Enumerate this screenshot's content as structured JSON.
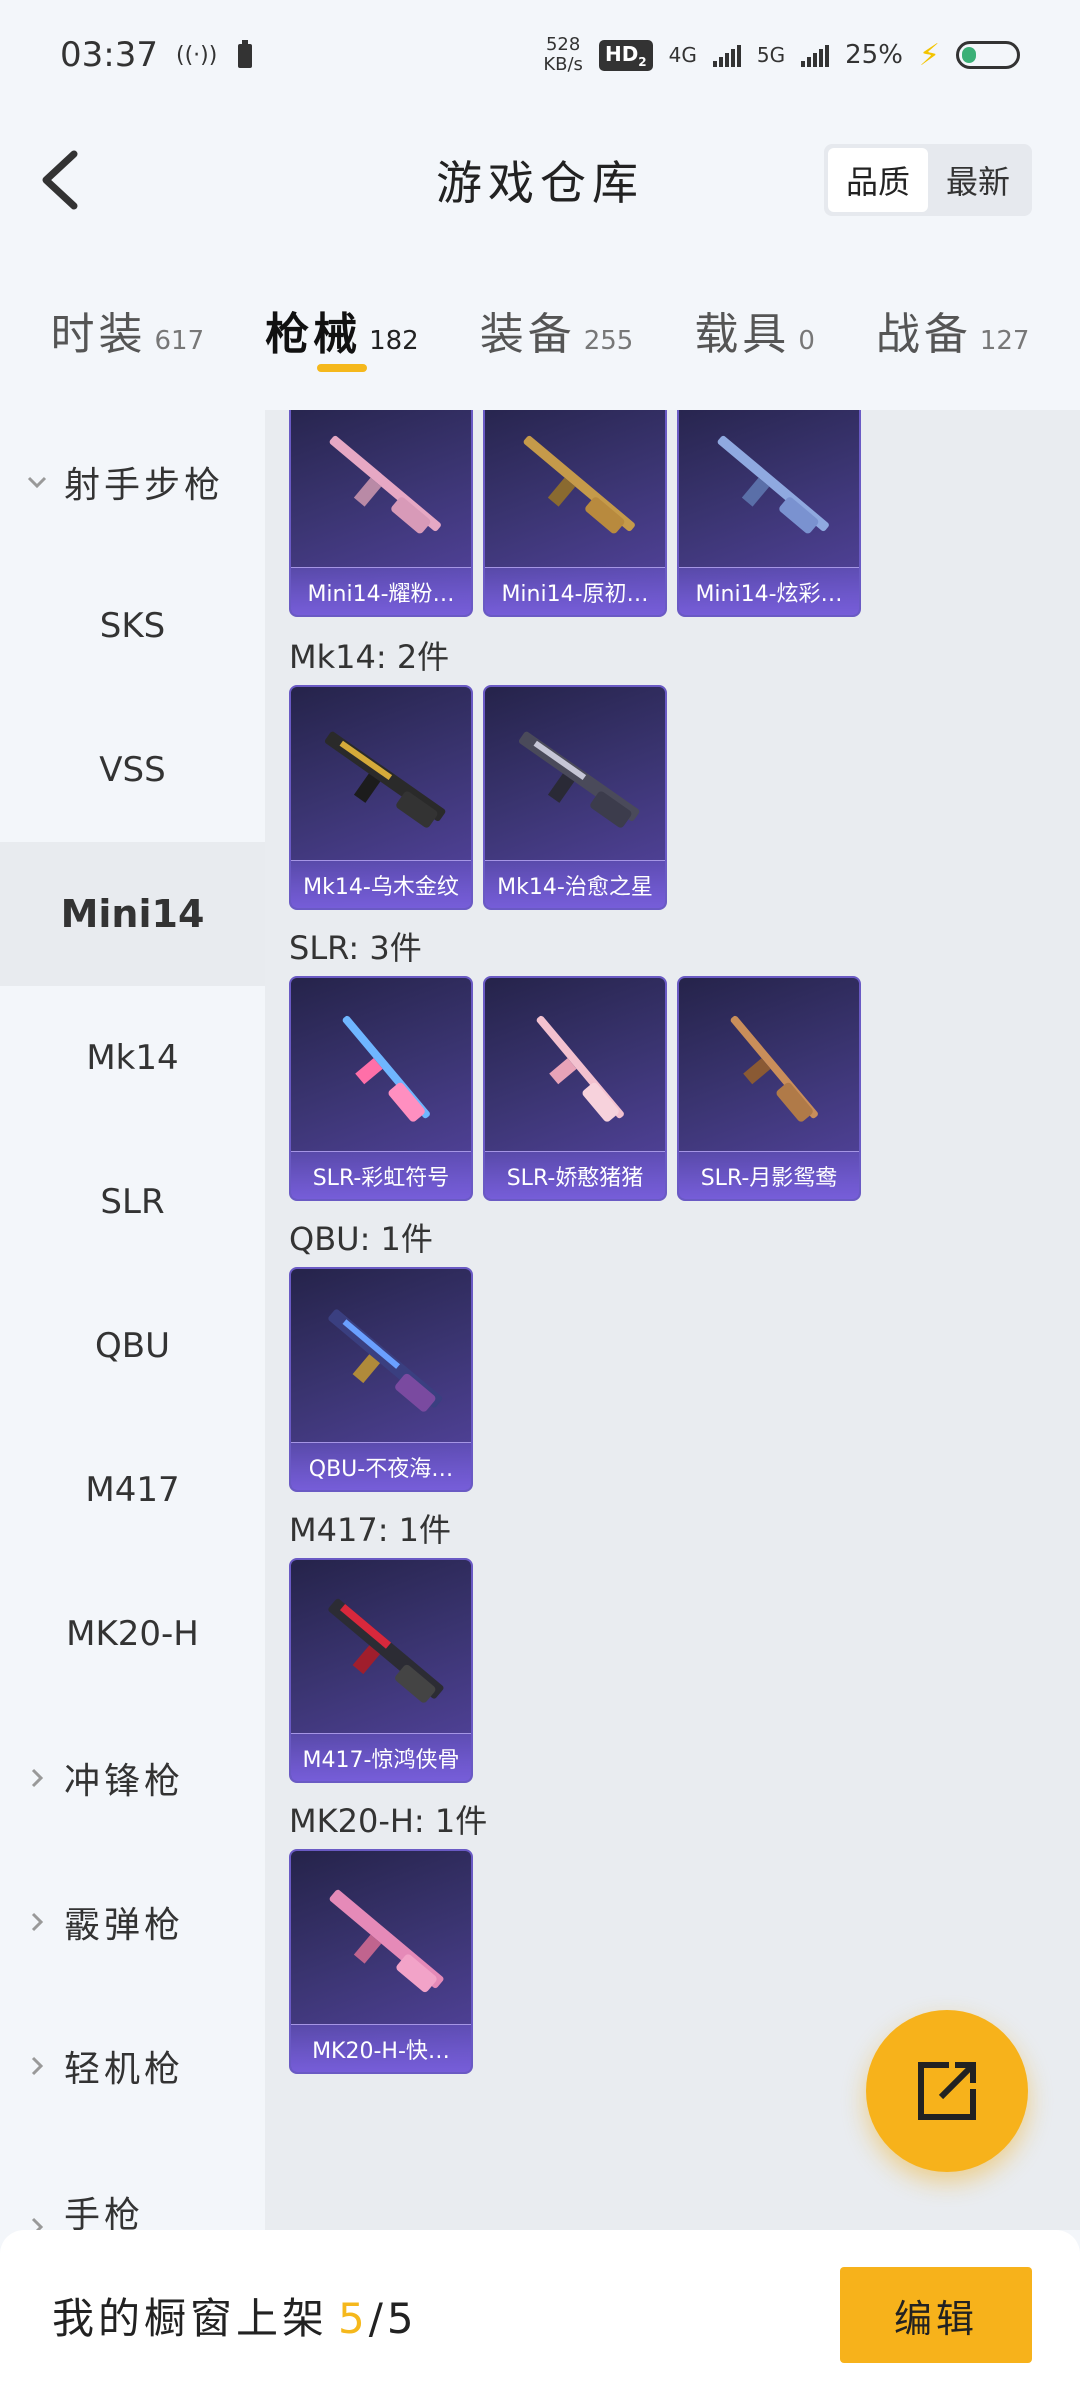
{
  "status_bar": {
    "time": "03:37",
    "net_speed_value": "528",
    "net_speed_unit": "KB/s",
    "hd_label": "HD",
    "hd_sub": "2",
    "sig1_label": "4G",
    "sig2_label": "5G",
    "battery_percent": "25%"
  },
  "header": {
    "title": "游戏仓库",
    "sort_options": [
      "品质",
      "最新"
    ],
    "sort_active": "品质"
  },
  "tabs": [
    {
      "label": "时装",
      "count": "617"
    },
    {
      "label": "枪械",
      "count": "182",
      "active": true
    },
    {
      "label": "装备",
      "count": "255"
    },
    {
      "label": "载具",
      "count": "0"
    },
    {
      "label": "战备",
      "count": "127"
    }
  ],
  "sidebar": {
    "group_rifles": "射手步枪",
    "items": [
      "SKS",
      "VSS",
      "Mini14",
      "Mk14",
      "SLR",
      "QBU",
      "M417",
      "MK20-H"
    ],
    "active_item": "Mini14",
    "group_smg": "冲锋枪",
    "group_shotgun": "霰弹枪",
    "group_lmg": "轻机枪",
    "group_pistol": "手枪"
  },
  "content": {
    "mini14_cards": [
      "Mini14-耀粉…",
      "Mini14-原初…",
      "Mini14-炫彩…"
    ],
    "mk14_label": "Mk14: 2件",
    "mk14_cards": [
      "Mk14-乌木金纹",
      "Mk14-治愈之星"
    ],
    "slr_label": "SLR: 3件",
    "slr_cards": [
      "SLR-彩虹符号",
      "SLR-娇憨猪猪",
      "SLR-月影鸳鸯"
    ],
    "qbu_label": "QBU: 1件",
    "qbu_cards": [
      "QBU-不夜海…"
    ],
    "m417_label": "M417: 1件",
    "m417_cards": [
      "M417-惊鸿侠骨"
    ],
    "mk20_label": "MK20-H: 1件",
    "mk20_cards": [
      "MK20-H-快…"
    ]
  },
  "bottom_bar": {
    "showcase_prefix": "我的橱窗上架",
    "showcase_count": "5",
    "showcase_total": "/5",
    "edit_label": "编辑"
  },
  "colors": {
    "accent": "#f7b21b",
    "card_bg": "#3a3470",
    "card_label": "#7a5fdc"
  }
}
